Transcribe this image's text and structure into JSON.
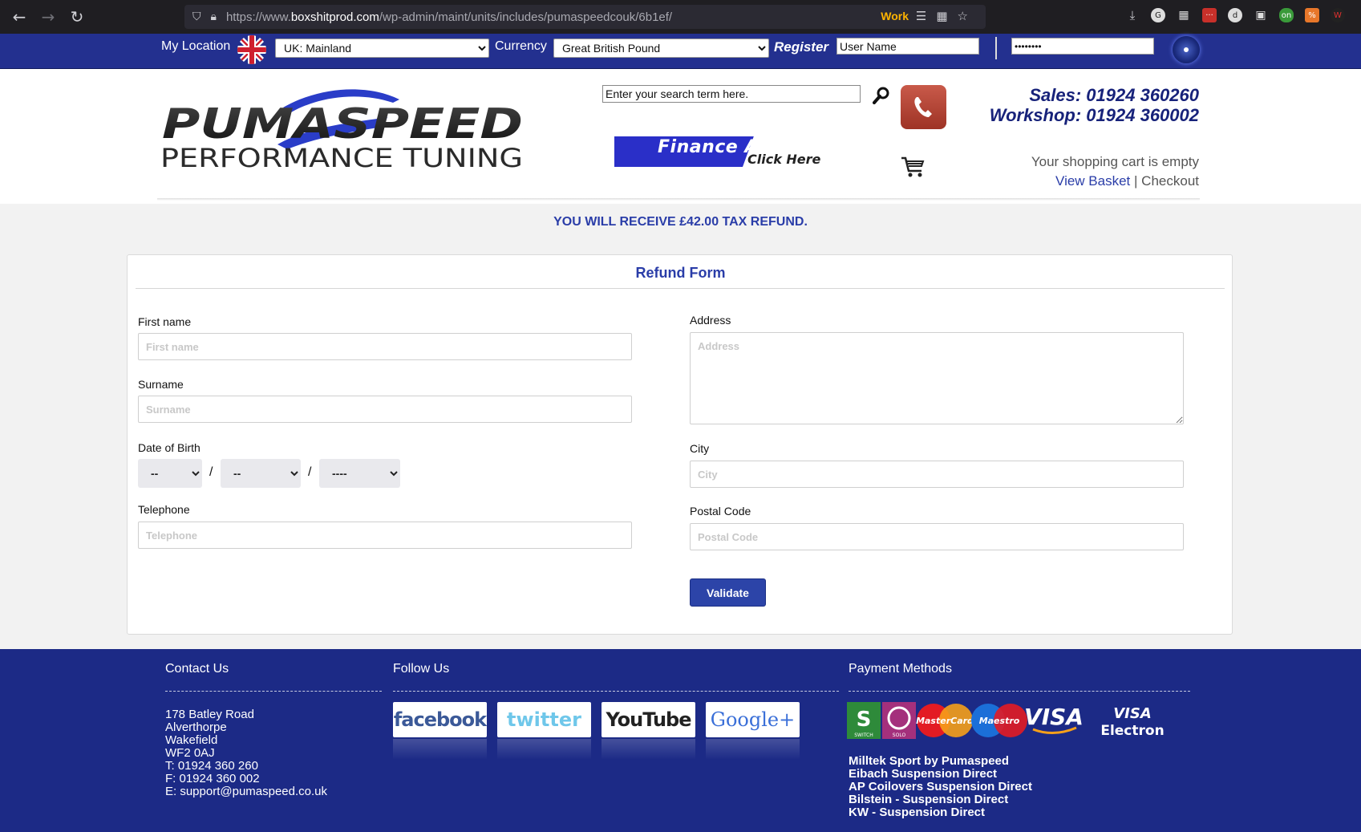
{
  "browser": {
    "url_prefix": "https://www.",
    "url_domain": "boxshitprod.com",
    "url_path": "/wp-admin/maint/units/includes/pumaspeedcouk/6b1ef/",
    "container_label": "Work"
  },
  "topbar": {
    "location_label": "My Location",
    "location_value": "UK: Mainland",
    "currency_label": "Currency",
    "currency_value": "Great British Pound",
    "register_label": "Register",
    "username_value": "User Name",
    "password_value": "••••••••"
  },
  "header": {
    "logo_line1": "PUMASPEED",
    "logo_line2": "PERFORMANCE TUNING",
    "search_value": "Enter your search term here.",
    "finance_line1": "Finance Available",
    "finance_line2": "Click Here",
    "sales_phone": "Sales: 01924 360260",
    "workshop_phone": "Workshop: 01924 360002",
    "cart_status": "Your shopping cart is empty",
    "view_basket": "View Basket",
    "separator": "|",
    "checkout": "Checkout"
  },
  "notice": "YOU WILL RECEIVE £42.00 TAX REFUND.",
  "form": {
    "title": "Refund Form",
    "first_name_label": "First name",
    "first_name_placeholder": "First name",
    "surname_label": "Surname",
    "surname_placeholder": "Surname",
    "dob_label": "Date of Birth",
    "dob_day": "--",
    "dob_month": "--",
    "dob_year": "----",
    "dob_sep": "/",
    "telephone_label": "Telephone",
    "telephone_placeholder": "Telephone",
    "address_label": "Address",
    "address_placeholder": "Address",
    "city_label": "City",
    "city_placeholder": "City",
    "postal_label": "Postal Code",
    "postal_placeholder": "Postal Code",
    "validate_label": "Validate"
  },
  "footer": {
    "contact_heading": "Contact Us",
    "follow_heading": "Follow Us",
    "payment_heading": "Payment Methods",
    "address_lines": [
      "178 Batley Road",
      "Alverthorpe",
      "Wakefield",
      "WF2 0AJ",
      "T: 01924 360 260",
      "F: 01924 360 002",
      "E: support@pumaspeed.co.uk"
    ],
    "social": [
      "facebook",
      "twitter",
      "YouTube",
      "Google+"
    ],
    "payment_cards": [
      "SWITCH",
      "SOLO",
      "MasterCard",
      "Maestro",
      "VISA",
      "VISA Electron"
    ],
    "brands": [
      "Milltek Sport by Pumaspeed",
      "Eibach Suspension Direct",
      "AP Coilovers Suspension Direct",
      "Bilstein - Suspension Direct",
      "KW - Suspension Direct"
    ]
  },
  "colors": {
    "brand_blue": "#23308f",
    "accent_blue": "#2a3da8",
    "footer_blue": "#1c2a86"
  }
}
